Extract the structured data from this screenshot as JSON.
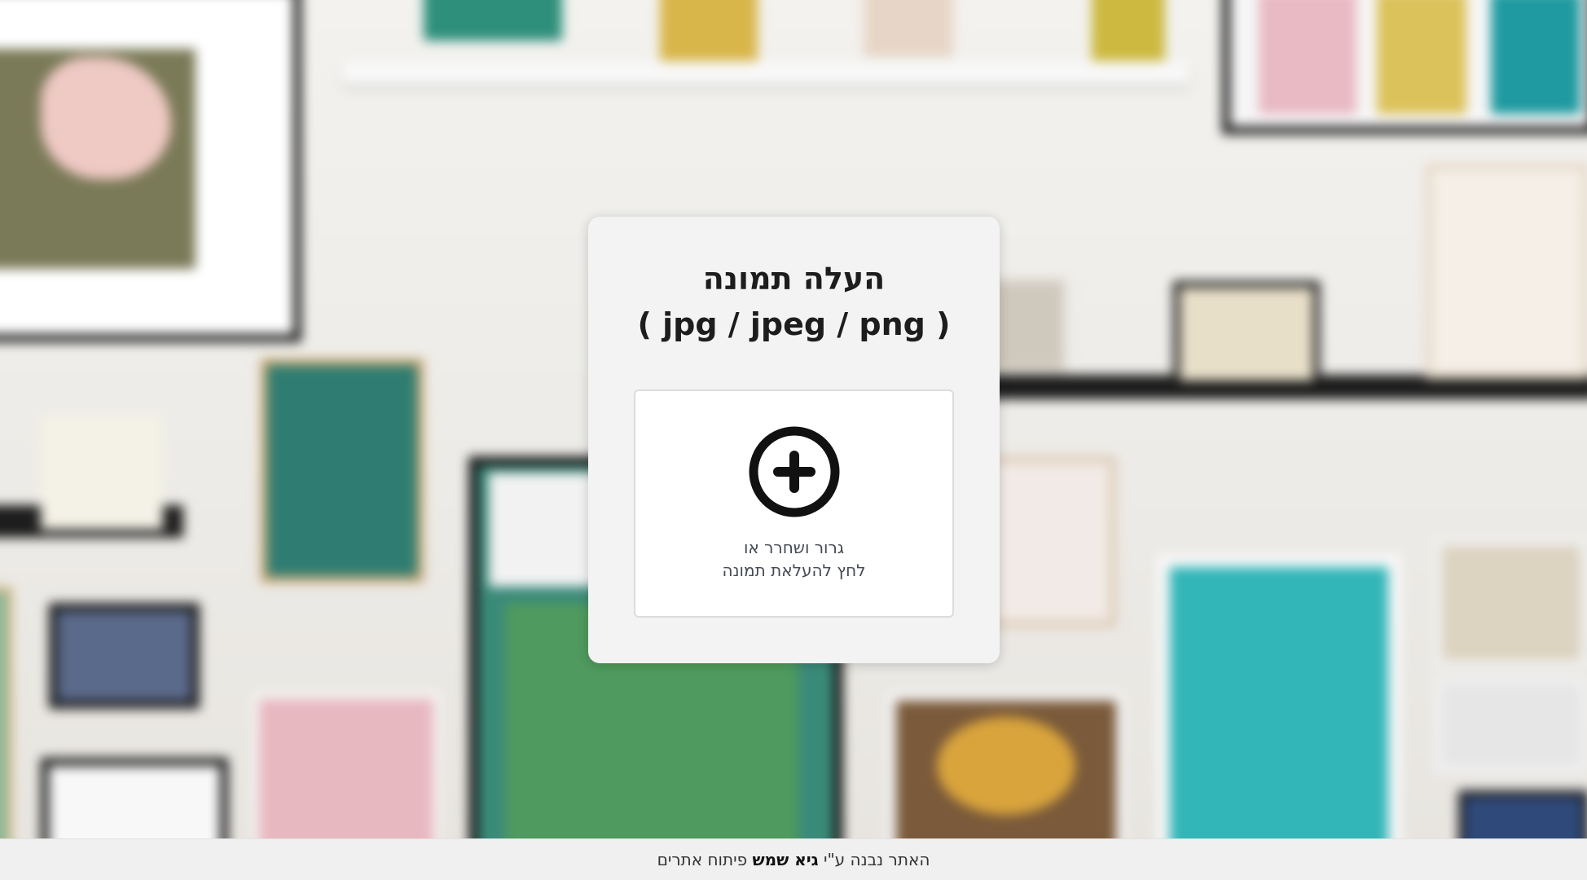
{
  "upload": {
    "title_line1": "העלה תמונה",
    "title_line2": "( jpg / jpeg / png )",
    "drop_line1": "גרור ושחרר או",
    "drop_line2": "לחץ להעלאת תמונה",
    "accept": ".jpg,.jpeg,.png"
  },
  "footer": {
    "prefix": "האתר נבנה ע\"י",
    "author": "גיא שמש",
    "suffix": "פיתוח אתרים"
  },
  "colors": {
    "card_bg": "#f3f3f3",
    "icon": "#111111",
    "footer_bg": "#f0f0f0"
  }
}
